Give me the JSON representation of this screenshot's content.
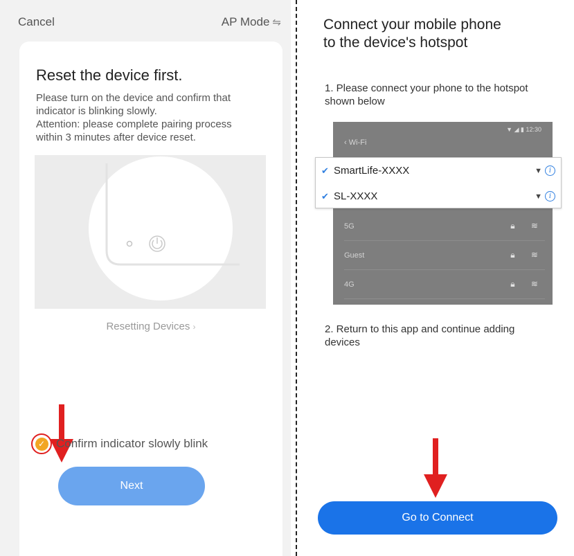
{
  "left": {
    "cancel_label": "Cancel",
    "mode_label": "AP Mode",
    "mode_icon": "swap-icon",
    "title": "Reset the device first.",
    "description": [
      "Please turn on the device and confirm that",
      "indicator is blinking slowly.",
      "Attention: please complete pairing process",
      "within 3 minutes after device reset."
    ],
    "reset_link": "Resetting Devices",
    "confirm_label": "Confirm indicator slowly blink",
    "confirm_checked": true,
    "next_label": "Next"
  },
  "right": {
    "title": [
      "Connect your mobile phone",
      "to the device's hotspot"
    ],
    "step1": [
      "1. Please connect your phone to the hotspot",
      "shown below"
    ],
    "phone": {
      "back_label": "Wi-Fi",
      "status_time": "12:30",
      "networks": [
        "5G",
        "Guest",
        "4G"
      ]
    },
    "hotspots": [
      "SmartLife-XXXX",
      "SL-XXXX"
    ],
    "step2": [
      "2. Return to this app and continue adding",
      "devices"
    ],
    "connect_label": "Go to Connect"
  },
  "colors": {
    "primary_button": "#1a73e8",
    "next_button": "#6aa5ee",
    "check": "#f2a623",
    "annotation_red": "#e02020"
  }
}
